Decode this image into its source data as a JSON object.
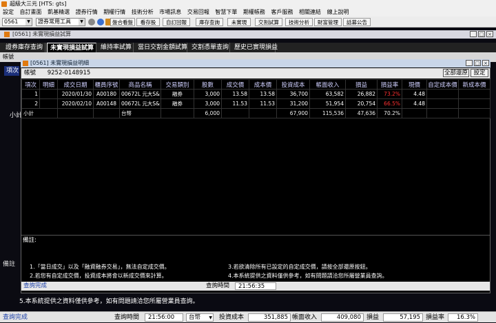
{
  "app": {
    "title": "超級大三元 [HTS: gts]"
  },
  "menu": [
    "設定",
    "自訂畫面",
    "凱基精選",
    "證券行情",
    "期權行情",
    "技術分析",
    "市場訊息",
    "交易回報",
    "智慧下單",
    "期權帳務",
    "客戶服務",
    "相關連結",
    "線上說明"
  ],
  "toolbar": {
    "code_value": "0561",
    "tools_select": "證券常用工具",
    "buttons": [
      "盤合看盤",
      "看存股",
      "自訂回報",
      "庫存查詢",
      "未實現",
      "交割試算",
      "技術分析",
      "財富管理",
      "話募公告"
    ]
  },
  "bg_window": {
    "title": "[0561] 未實現損益試算",
    "tabs": [
      "證券庫存查詢",
      "未實現損益試算",
      "維持率試算",
      "當日交割金額試算",
      "交割憑單查詢",
      "歷史已實現損益"
    ],
    "active_tab": 1,
    "toolbar_text": "帳號",
    "side_top": "項次",
    "side_mid": "小計",
    "note_label": "備註",
    "note_line": "5.本系統提供之資料僅供參考，如有問題請洽您所屬營業員查詢。"
  },
  "detail_window": {
    "title": "[0561] 未實現損益明細",
    "account_label": "帳號",
    "account_value": "9252-0148915",
    "btn_restore_all": "全部還原",
    "btn_settings": "設定",
    "columns": [
      "項次",
      "明細",
      "成交日期",
      "櫃員序號",
      "商品名稱",
      "交易類別",
      "股數",
      "成交價",
      "成本價",
      "投資成本",
      "帳面收入",
      "損益",
      "損益率",
      "現價",
      "自定成本價",
      "新成本價"
    ],
    "rows": [
      {
        "idx": "1",
        "detail": "",
        "date": "2020/01/30",
        "teller": "A00180",
        "name": "00672L 元大S&",
        "type": "融券",
        "shares": "3,000",
        "price": "13.58",
        "cost_price": "13.58",
        "invest_cost": "36,700",
        "book_income": "63,582",
        "pnl": "26,882",
        "pnl_rate": "73.2%",
        "cur_price": "4.48",
        "custom_cost": "",
        "new_cost": ""
      },
      {
        "idx": "2",
        "detail": "",
        "date": "2020/02/10",
        "teller": "A00148",
        "name": "00672L 元大S&",
        "type": "融券",
        "shares": "3,000",
        "price": "11.53",
        "cost_price": "11.53",
        "invest_cost": "31,200",
        "book_income": "51,954",
        "pnl": "20,754",
        "pnl_rate": "66.5%",
        "cur_price": "4.48",
        "custom_cost": "",
        "new_cost": ""
      }
    ],
    "subtotal": {
      "label": "小計",
      "name": "台幣",
      "shares": "6,000",
      "invest_cost": "67,900",
      "book_income": "115,536",
      "pnl": "47,636",
      "pnl_rate": "70.2%"
    },
    "notes_label": "備註:",
    "notes": [
      "1.「當日成交」以及「融資融券交易」，無法自定成交價。",
      "2.若您有自定成交價，投資成本將會以新成交價來計算。",
      "3.若欲清除所有已設定的自定成交價，請按全部還原按鈕。",
      "4.本系統提供之資料僅供參考，如有問題請洽您所屬營業員查詢。"
    ],
    "status": {
      "message": "查詢完成",
      "time_label": "查詢時間",
      "time_value": "21:56:35"
    }
  },
  "statusbar": {
    "message": "查詢完成",
    "time_label": "查詢時間",
    "time_value": "21:56:00",
    "currency": "台幣",
    "invest_cost_label": "投資成本",
    "invest_cost": "351,885",
    "book_income_label": "帳面收入",
    "book_income": "409,080",
    "pnl_label": "損益",
    "pnl": "57,195",
    "pnl_rate_label": "損益率",
    "pnl_rate": "16.3%"
  }
}
